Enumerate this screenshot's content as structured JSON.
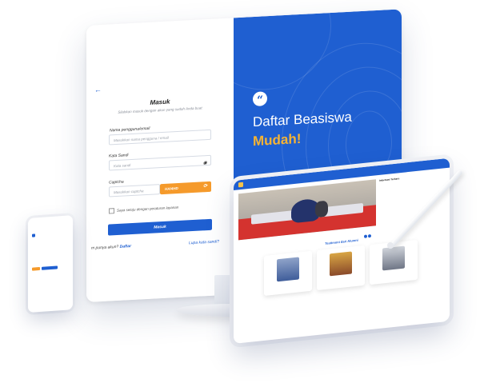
{
  "login": {
    "back_icon": "arrow-left-icon",
    "title": "Masuk",
    "subtitle": "Silahkan masuk dengan akun yang sudah Anda buat",
    "username_label": "Nama pengguna/email",
    "username_placeholder": "Masukkan nama pengguna / email",
    "password_label": "Kata Sandi",
    "password_placeholder": "Kata sandi",
    "captcha_label": "Captcha",
    "captcha_placeholder": "Masukkan captcha",
    "captcha_code": "HAI4HD",
    "terms_text": "Saya setuju dengan peraturan layanan",
    "submit_label": "Masuk",
    "register_prefix": "m punya akun?",
    "register_link": "Daftar",
    "forgot_link": "Lupa kata sandi?"
  },
  "hero": {
    "quote_icon": "quote-icon",
    "line1": "Daftar Beasiswa",
    "line2": "Mudah!",
    "accent_color": "#f5b334",
    "brand_color": "#1f5fd1"
  },
  "tablet": {
    "info_title": "Informasi Terbaru",
    "section_title": "Testimoni dari Alumni"
  }
}
